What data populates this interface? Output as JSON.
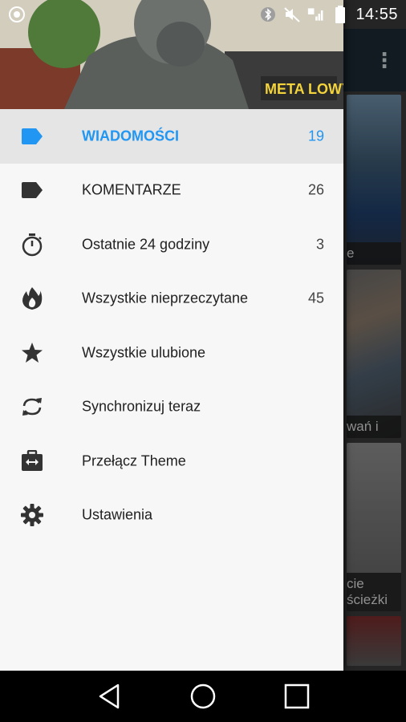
{
  "status_bar": {
    "time": "14:55",
    "icons": [
      "app-notification-icon",
      "bluetooth-icon",
      "mute-icon",
      "signal-icon",
      "battery-icon"
    ]
  },
  "background_app": {
    "cards": [
      {
        "caption": "e"
      },
      {
        "caption": "wań i"
      },
      {
        "caption": "cie\nścieżki"
      },
      {
        "caption": ""
      }
    ]
  },
  "drawer": {
    "header_sign_text": "META LOWY",
    "items": [
      {
        "icon": "label-icon",
        "label": "WIADOMOŚCI",
        "count": "19",
        "active": true
      },
      {
        "icon": "label-icon",
        "label": "KOMENTARZE",
        "count": "26",
        "active": false
      },
      {
        "icon": "timer-icon",
        "label": "Ostatnie 24 godziny",
        "count": "3",
        "active": false
      },
      {
        "icon": "flame-icon",
        "label": "Wszystkie nieprzeczytane",
        "count": "45",
        "active": false
      },
      {
        "icon": "star-icon",
        "label": "Wszystkie ulubione",
        "count": "",
        "active": false
      },
      {
        "icon": "sync-icon",
        "label": "Synchronizuj teraz",
        "count": "",
        "active": false
      },
      {
        "icon": "switch-theme-icon",
        "label": "Przełącz Theme",
        "count": "",
        "active": false
      },
      {
        "icon": "gear-icon",
        "label": "Ustawienia",
        "count": "",
        "active": false
      }
    ]
  },
  "colors": {
    "accent": "#2196f3",
    "drawer_bg": "#f7f7f7",
    "active_row_bg": "#e5e5e5",
    "icon": "#333333"
  },
  "system_nav": {
    "buttons": [
      "back-icon",
      "home-icon",
      "recents-icon"
    ]
  }
}
